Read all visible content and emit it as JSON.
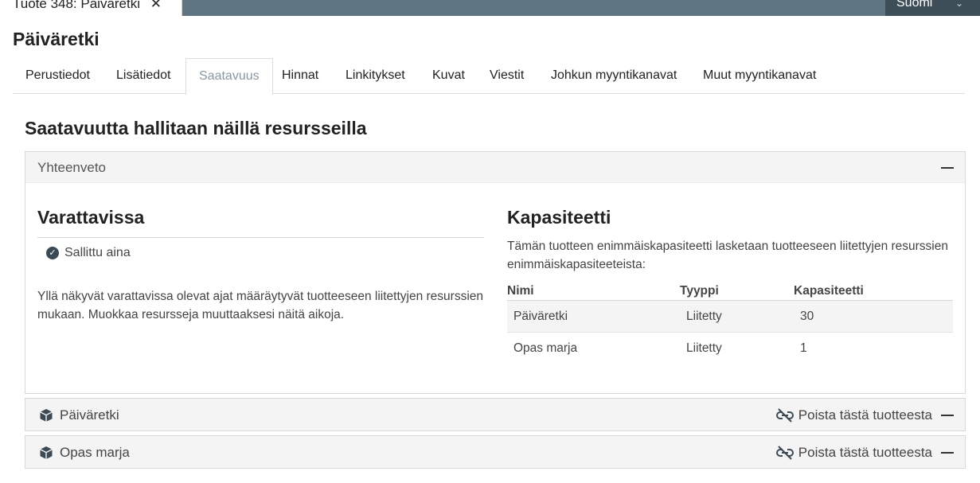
{
  "window": {
    "tab_title": "Tuote 348: Päiväretki",
    "close_glyph": "✕",
    "language": "Suomi"
  },
  "page": {
    "title": "Päiväretki"
  },
  "tabs": [
    {
      "label": "Perustiedot"
    },
    {
      "label": "Lisätiedot"
    },
    {
      "label": "Saatavuus",
      "active": true
    },
    {
      "label": "Hinnat"
    },
    {
      "label": "Linkitykset"
    },
    {
      "label": "Kuvat"
    },
    {
      "label": "Viestit"
    },
    {
      "label": "Johkun myyntikanavat"
    },
    {
      "label": "Muut myyntikanavat"
    }
  ],
  "section": {
    "title": "Saatavuutta hallitaan näillä resursseilla"
  },
  "summary": {
    "header": "Yhteenveto",
    "bookable": {
      "title": "Varattavissa",
      "status": "Sallittu aina",
      "note": "Yllä näkyvät varattavissa olevat ajat määräytyvät tuotteeseen liitettyjen resurssien mukaan. Muokkaa resursseja muuttaaksesi näitä aikoja."
    },
    "capacity": {
      "title": "Kapasiteetti",
      "description": "Tämän tuotteen enimmäiskapasiteetti lasketaan tuotteeseen liitettyjen resurssien enimmäiskapasiteeteista:",
      "columns": [
        "Nimi",
        "Tyyppi",
        "Kapasiteetti"
      ],
      "rows": [
        {
          "name": "Päiväretki",
          "type": "Liitetty",
          "capacity": "30"
        },
        {
          "name": "Opas marja",
          "type": "Liitetty",
          "capacity": "1"
        }
      ]
    }
  },
  "resources": [
    {
      "name": "Päiväretki",
      "remove_label": "Poista tästä tuotteesta"
    },
    {
      "name": "Opas marja",
      "remove_label": "Poista tästä tuotteesta"
    }
  ],
  "colors": {
    "topbar": "#5f7583",
    "language_bg": "#3e4e58",
    "active_tab_text": "#8a98a3"
  }
}
